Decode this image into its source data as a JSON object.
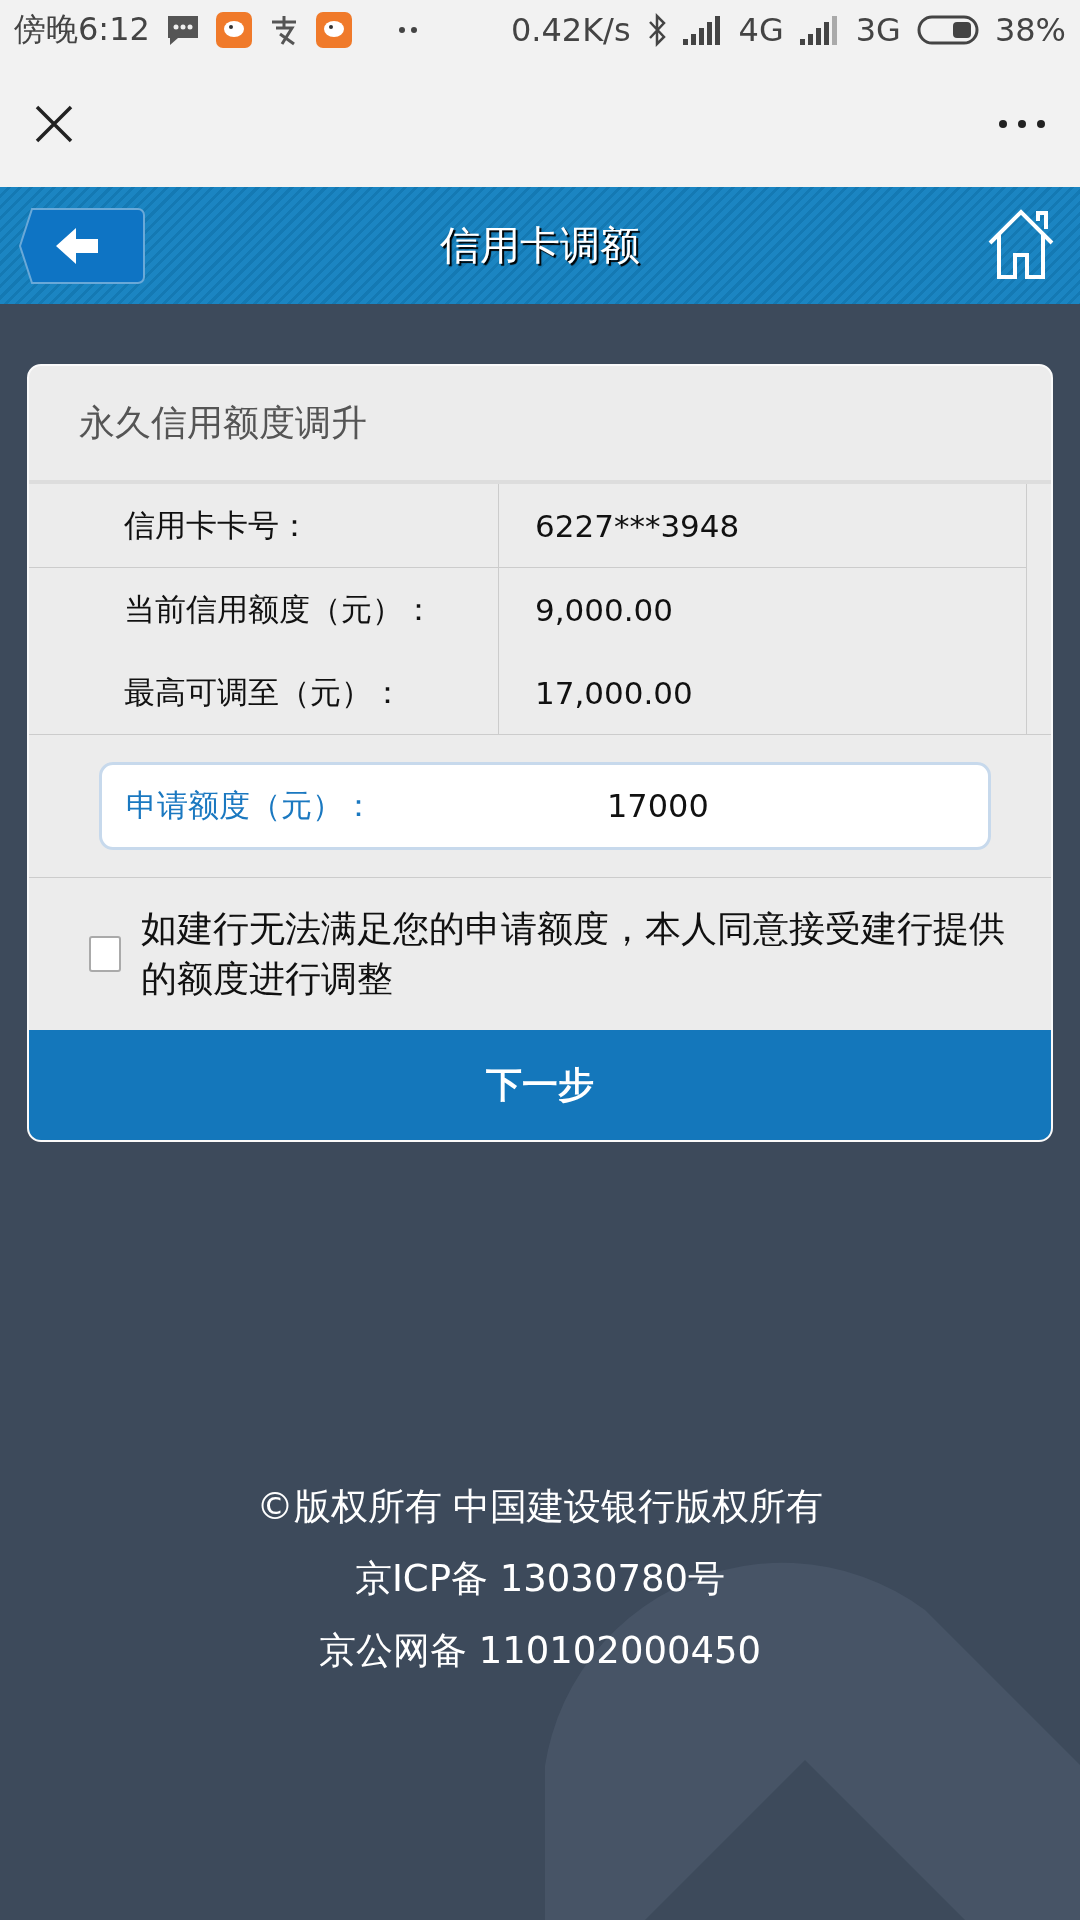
{
  "status_bar": {
    "time": "傍晚6:12",
    "network_speed": "0.42K/s",
    "network_1": "4G",
    "network_2": "3G",
    "battery": "38%"
  },
  "header": {
    "title": "信用卡调额"
  },
  "card": {
    "title": "永久信用额度调升",
    "rows": [
      {
        "label": "信用卡卡号：",
        "value": "6227***3948"
      },
      {
        "label": "当前信用额度（元）：",
        "value": "9,000.00"
      },
      {
        "label": "最高可调至（元）：",
        "value": "17,000.00"
      }
    ],
    "apply": {
      "label": "申请额度（元）：",
      "value": "17000"
    },
    "agreement": {
      "text": " 如建行无法满足您的申请额度，本人同意接受建行提供的额度进行调整",
      "checked": false
    },
    "button": "下一步"
  },
  "footer": [
    "©版权所有 中国建设银行版权所有",
    "京ICP备 13030780号",
    "京公网备 110102000450"
  ]
}
